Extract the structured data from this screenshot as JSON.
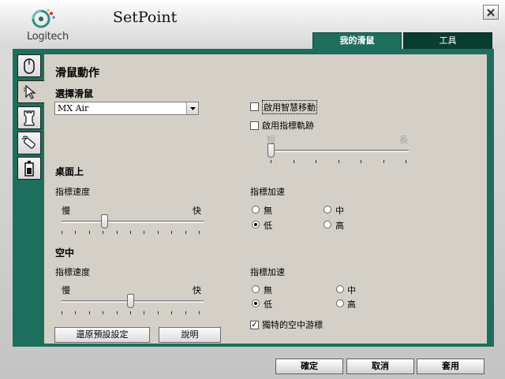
{
  "app": {
    "logo_text": "Logitech",
    "title": "SetPoint"
  },
  "tabs": [
    {
      "label": "我的滑鼠",
      "active": true
    },
    {
      "label": "工具",
      "active": false
    }
  ],
  "sidebar": {
    "icons": [
      "mouse-icon",
      "pointer-icon",
      "chess-rook-icon",
      "remote-icon",
      "battery-icon"
    ],
    "active_index": 1
  },
  "main": {
    "section_title": "滑鼠動作",
    "select_label": "選擇滑鼠",
    "select_value": "MX Air",
    "smart_move": {
      "label": "啟用智慧移動",
      "checked": false
    },
    "pointer_trails": {
      "label": "啟用指標軌跡",
      "checked": false,
      "min_label": "短",
      "max_label": "長",
      "value_fraction": 0.0
    },
    "desktop": {
      "title": "桌面上",
      "speed_label": "指標速度",
      "slow": "慢",
      "fast": "快",
      "speed_fraction": 0.31,
      "accel_label": "指標加速",
      "accel_options": [
        "無",
        "中",
        "低",
        "高"
      ],
      "accel_selected": "低"
    },
    "air": {
      "title": "空中",
      "speed_label": "指標速度",
      "slow": "慢",
      "fast": "快",
      "speed_fraction": 0.5,
      "accel_label": "指標加速",
      "accel_options": [
        "無",
        "中",
        "低",
        "高"
      ],
      "accel_selected": "低",
      "unique_air_cursor": {
        "label": "獨特的空中游標",
        "checked": true
      }
    },
    "restore_button": "還原預設設定",
    "help_button": "說明"
  },
  "footer": {
    "ok": "確定",
    "cancel": "取消",
    "apply": "套用"
  }
}
